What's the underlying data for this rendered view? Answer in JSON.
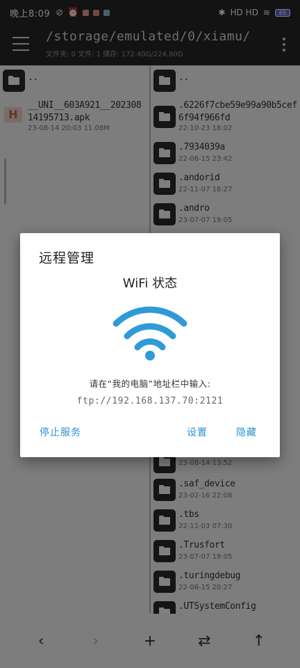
{
  "status_bar": {
    "time": "晚上8:09",
    "right_text": "HD HD",
    "battery": "65"
  },
  "app_bar": {
    "path": "/storage/emulated/0/xiamu/",
    "stats": "文件夹: 0  文件: 1  储存: 172.40G/224.80G"
  },
  "left_pane": {
    "items": [
      {
        "name": "..",
        "meta": "",
        "icon": "folder-icon"
      },
      {
        "name": "__UNI__603A921__202308",
        "name2": "14195713.apk",
        "meta": "23-08-14 20:03 11.08M",
        "icon": "apk-icon",
        "icon_letter": "H"
      }
    ]
  },
  "right_pane": {
    "items": [
      {
        "name": "..",
        "meta": ""
      },
      {
        "name": ".6226f7cbe59e99a90b5cef",
        "name2": "6f94f966fd",
        "meta": "22-10-23 18:02"
      },
      {
        "name": ".7934039a",
        "meta": "22-06-15 23:42"
      },
      {
        "name": ".andorid",
        "meta": "22-11-07 18:27"
      },
      {
        "name": ".andro",
        "meta": "23-07-07 19:05"
      },
      {
        "name": "",
        "meta": "23-08-14 13:52"
      },
      {
        "name": ".saf_device",
        "meta": "23-02-16 22:08"
      },
      {
        "name": ".tbs",
        "meta": "22-11-03 07:30"
      },
      {
        "name": ".Trusfort",
        "meta": "23-07-07 19:05"
      },
      {
        "name": ".turingdebug",
        "meta": "22-06-15 20:27"
      },
      {
        "name": ".UTSystemConfig",
        "meta": ""
      }
    ]
  },
  "bottom_bar": {
    "back": "‹",
    "forward": "›",
    "add": "+",
    "swap": "⇄",
    "up": "↑"
  },
  "dialog": {
    "title": "远程管理",
    "wifi_title": "WiFi 状态",
    "instruction": "请在“我的电脑”地址栏中输入:",
    "address": "ftp://192.168.137.70:2121",
    "stop_label": "停止服务",
    "settings_label": "设置",
    "hide_label": "隐藏"
  },
  "colors": {
    "accent": "#2b8fd1",
    "wifi": "#2e9ad8",
    "toolbar": "#262626"
  }
}
